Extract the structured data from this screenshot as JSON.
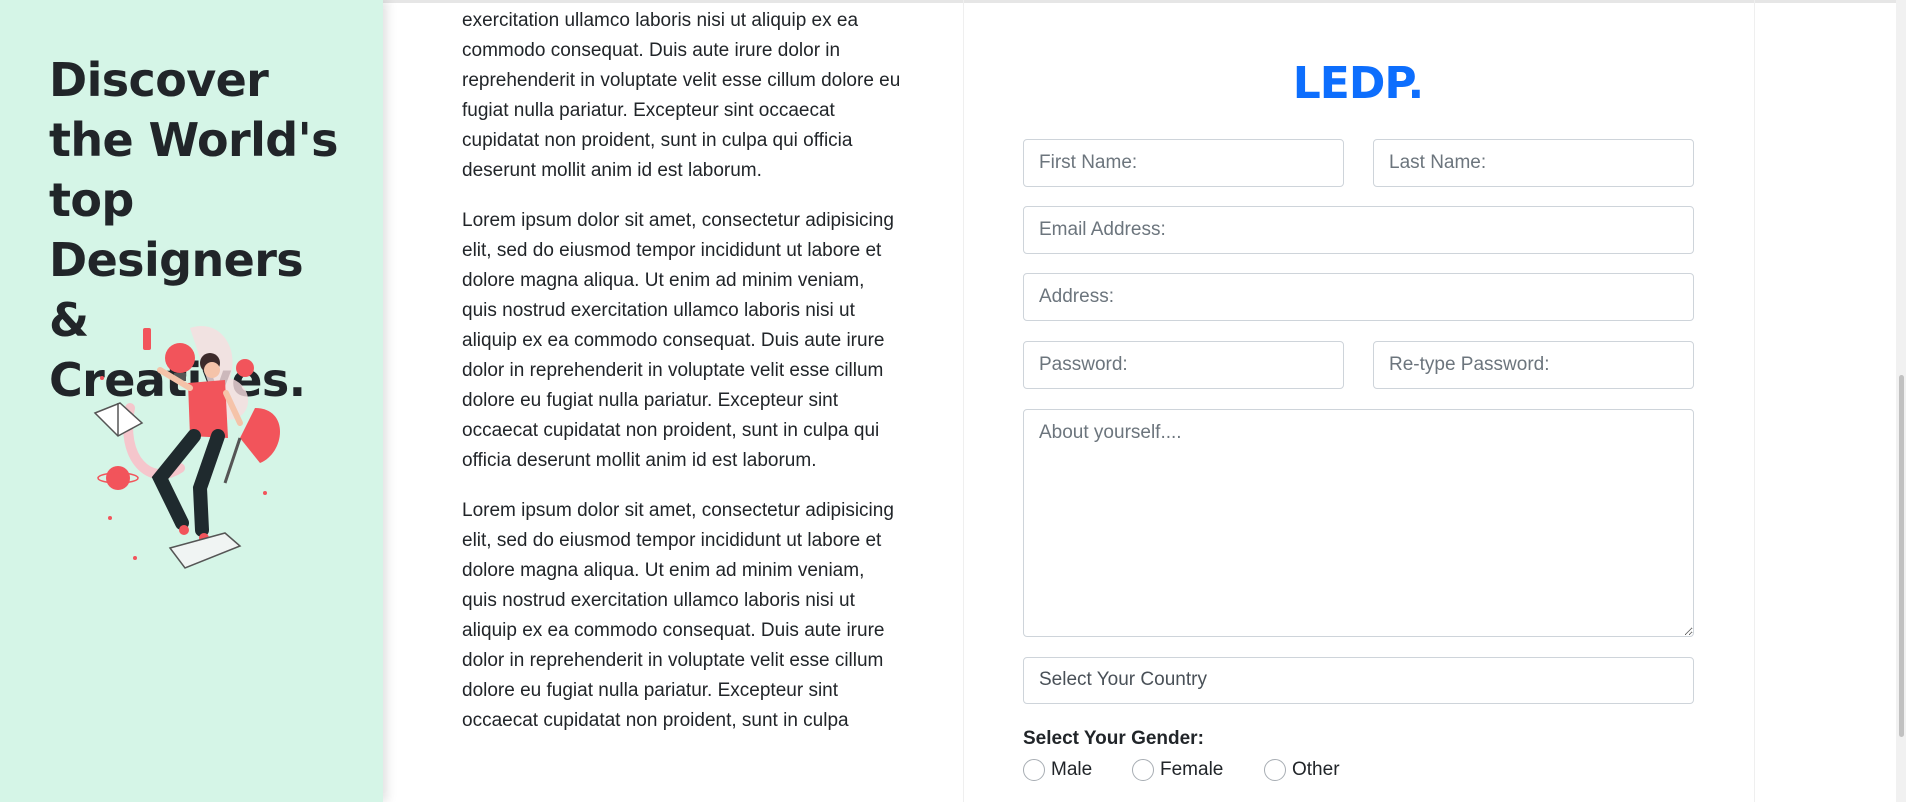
{
  "sidebar": {
    "heading": "Discover the World's top Designers & Creatives."
  },
  "article": {
    "partial_paragraph": "exercitation ullamco laboris nisi ut aliquip ex ea commodo consequat. Duis aute irure dolor in reprehenderit in voluptate velit esse cillum dolore eu fugiat nulla pariatur. Excepteur sint occaecat cupidatat non proident, sunt in culpa qui officia deserunt mollit anim id est laborum.",
    "paragraph": "Lorem ipsum dolor sit amet, consectetur adipisicing elit, sed do eiusmod tempor incididunt ut labore et dolore magna aliqua. Ut enim ad minim veniam, quis nostrud exercitation ullamco laboris nisi ut aliquip ex ea commodo consequat. Duis aute irure dolor in reprehenderit in voluptate velit esse cillum dolore eu fugiat nulla pariatur. Excepteur sint occaecat cupidatat non proident, sunt in culpa qui officia deserunt mollit anim id est laborum.",
    "paragraph_partial_end": "Lorem ipsum dolor sit amet, consectetur adipisicing elit, sed do eiusmod tempor incididunt ut labore et dolore magna aliqua. Ut enim ad minim veniam, quis nostrud exercitation ullamco laboris nisi ut aliquip ex ea commodo consequat. Duis aute irure dolor in reprehenderit in voluptate velit esse cillum dolore eu fugiat nulla pariatur. Excepteur sint occaecat cupidatat non proident, sunt in culpa"
  },
  "form": {
    "logo": "LEDP.",
    "first_name_placeholder": "First Name:",
    "last_name_placeholder": "Last Name:",
    "email_placeholder": "Email Address:",
    "address_placeholder": "Address:",
    "password_placeholder": "Password:",
    "retype_password_placeholder": "Re-type Password:",
    "about_placeholder": "About yourself....",
    "country_selected": "Select Your Country",
    "gender_label": "Select Your Gender:",
    "gender_options": [
      "Male",
      "Female",
      "Other"
    ]
  },
  "colors": {
    "sidebar_bg": "#d5f5e7",
    "logo": "#0d6efd",
    "illustration_accent": "#f2545b"
  }
}
